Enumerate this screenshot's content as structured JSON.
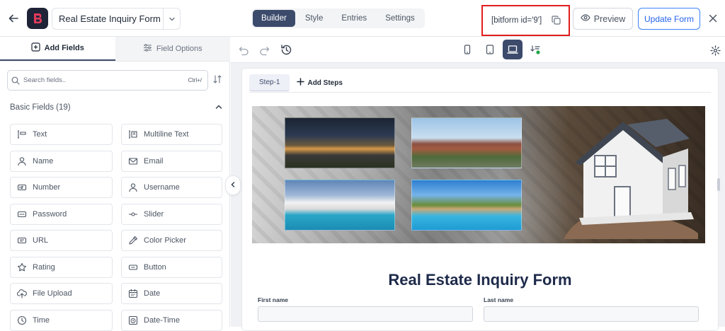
{
  "header": {
    "form_title": "Real Estate Inquiry Form",
    "tabs": [
      {
        "label": "Builder",
        "active": true
      },
      {
        "label": "Style",
        "active": false
      },
      {
        "label": "Entries",
        "active": false
      },
      {
        "label": "Settings",
        "active": false
      }
    ],
    "shortcode": "[bitform id='9']",
    "preview_label": "Preview",
    "update_label": "Update Form",
    "accent_color": "#3c4a6b",
    "highlight_color": "#e11d1d"
  },
  "left_panel": {
    "tabs": [
      {
        "label": "Add Fields",
        "icon": "plus-square-icon",
        "active": true
      },
      {
        "label": "Field Options",
        "icon": "sliders-icon",
        "active": false
      }
    ],
    "search": {
      "placeholder": "Search fields..",
      "shortcut": "Ctrl+/"
    },
    "section_title": "Basic Fields (19)",
    "fields": [
      {
        "label": "Text",
        "icon": "text-cursor-icon"
      },
      {
        "label": "Multiline Text",
        "icon": "multiline-text-icon"
      },
      {
        "label": "Name",
        "icon": "user-icon"
      },
      {
        "label": "Email",
        "icon": "mail-icon"
      },
      {
        "label": "Number",
        "icon": "number-icon"
      },
      {
        "label": "Username",
        "icon": "user-icon"
      },
      {
        "label": "Password",
        "icon": "password-icon"
      },
      {
        "label": "Slider",
        "icon": "slider-icon"
      },
      {
        "label": "URL",
        "icon": "url-icon"
      },
      {
        "label": "Color Picker",
        "icon": "color-picker-icon"
      },
      {
        "label": "Rating",
        "icon": "star-icon"
      },
      {
        "label": "Button",
        "icon": "button-icon"
      },
      {
        "label": "File Upload",
        "icon": "upload-icon"
      },
      {
        "label": "Date",
        "icon": "calendar-icon"
      },
      {
        "label": "Time",
        "icon": "clock-icon"
      },
      {
        "label": "Date-Time",
        "icon": "date-time-icon"
      }
    ]
  },
  "canvas": {
    "step_label": "Step-1",
    "add_steps_label": "Add Steps",
    "form_heading": "Real Estate Inquiry Form",
    "first_name_label": "First name",
    "last_name_label": "Last name"
  }
}
